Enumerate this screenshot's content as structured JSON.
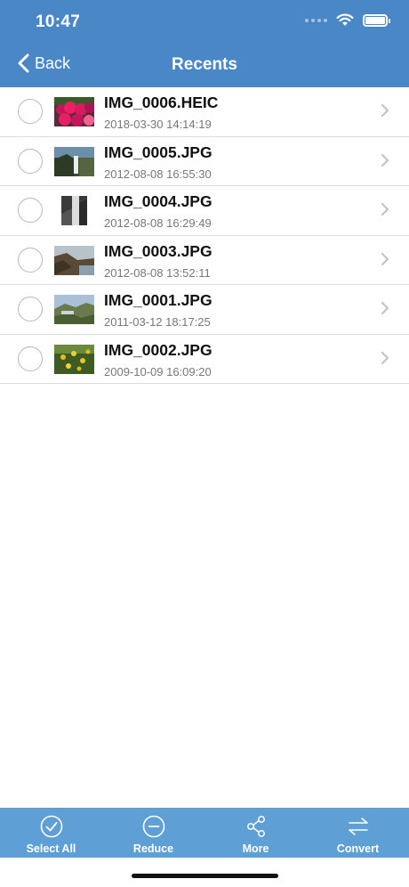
{
  "status_bar": {
    "time": "10:47"
  },
  "nav": {
    "back_label": "Back",
    "title": "Recents"
  },
  "files": [
    {
      "name": "IMG_0006.HEIC",
      "date": "2018-03-30 14:14:19",
      "thumb": "flowers"
    },
    {
      "name": "IMG_0005.JPG",
      "date": "2012-08-08 16:55:30",
      "thumb": "waterfall-landscape"
    },
    {
      "name": "IMG_0004.JPG",
      "date": "2012-08-08 16:29:49",
      "thumb": "waterfall-portrait"
    },
    {
      "name": "IMG_0003.JPG",
      "date": "2012-08-08 13:52:11",
      "thumb": "coast-cliffs"
    },
    {
      "name": "IMG_0001.JPG",
      "date": "2011-03-12 18:17:25",
      "thumb": "hills-lake"
    },
    {
      "name": "IMG_0002.JPG",
      "date": "2009-10-09 16:09:20",
      "thumb": "yellow-flowers"
    }
  ],
  "toolbar": {
    "select_all": "Select All",
    "reduce": "Reduce",
    "more": "More",
    "convert": "Convert"
  },
  "colors": {
    "nav_bar": "#4a87c7",
    "toolbar": "#5e9fd6"
  },
  "icons": {
    "back": "chevron-left-icon",
    "select_all": "check-circle-icon",
    "reduce": "minus-circle-icon",
    "more": "share-icon",
    "convert": "swap-arrows-icon"
  }
}
